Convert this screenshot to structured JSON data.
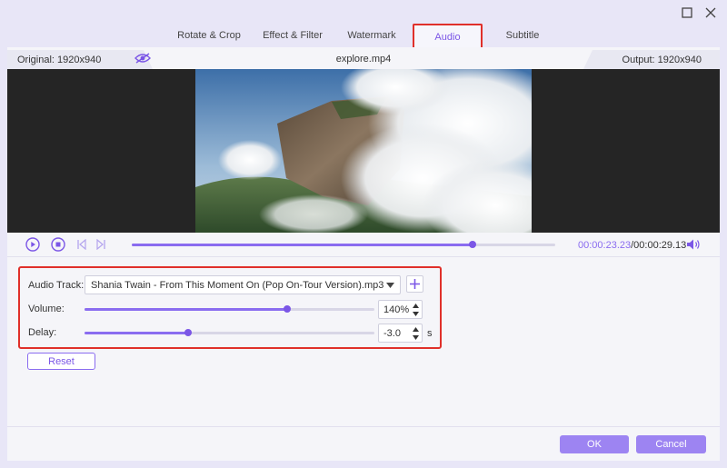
{
  "window": {
    "minimize_icon": "square-icon",
    "close_icon": "close-icon"
  },
  "tabs": [
    {
      "label": "Rotate & Crop",
      "active": false
    },
    {
      "label": "Effect & Filter",
      "active": false
    },
    {
      "label": "Watermark",
      "active": false
    },
    {
      "label": "Audio",
      "active": true
    },
    {
      "label": "Subtitle",
      "active": false
    }
  ],
  "info": {
    "original": "Original: 1920x940",
    "file_name": "explore.mp4",
    "output": "Output: 1920x940"
  },
  "player": {
    "current_time": "00:00:23.23",
    "total_time": "/00:00:29.13",
    "progress": 0.805
  },
  "audio": {
    "track_label": "Audio Track:",
    "track_value": "Shania Twain - From This Moment On (Pop On-Tour Version).mp3",
    "volume_label": "Volume:",
    "volume_value": "140%",
    "volume_level": 0.7,
    "delay_label": "Delay:",
    "delay_value": "-3.0",
    "delay_level": 0.357,
    "delay_unit": "s"
  },
  "buttons": {
    "reset": "Reset",
    "ok": "OK",
    "cancel": "Cancel"
  },
  "colors": {
    "accent": "#7b56e6",
    "highlight_border": "#e0302a",
    "primary_button": "#9d84f2"
  }
}
